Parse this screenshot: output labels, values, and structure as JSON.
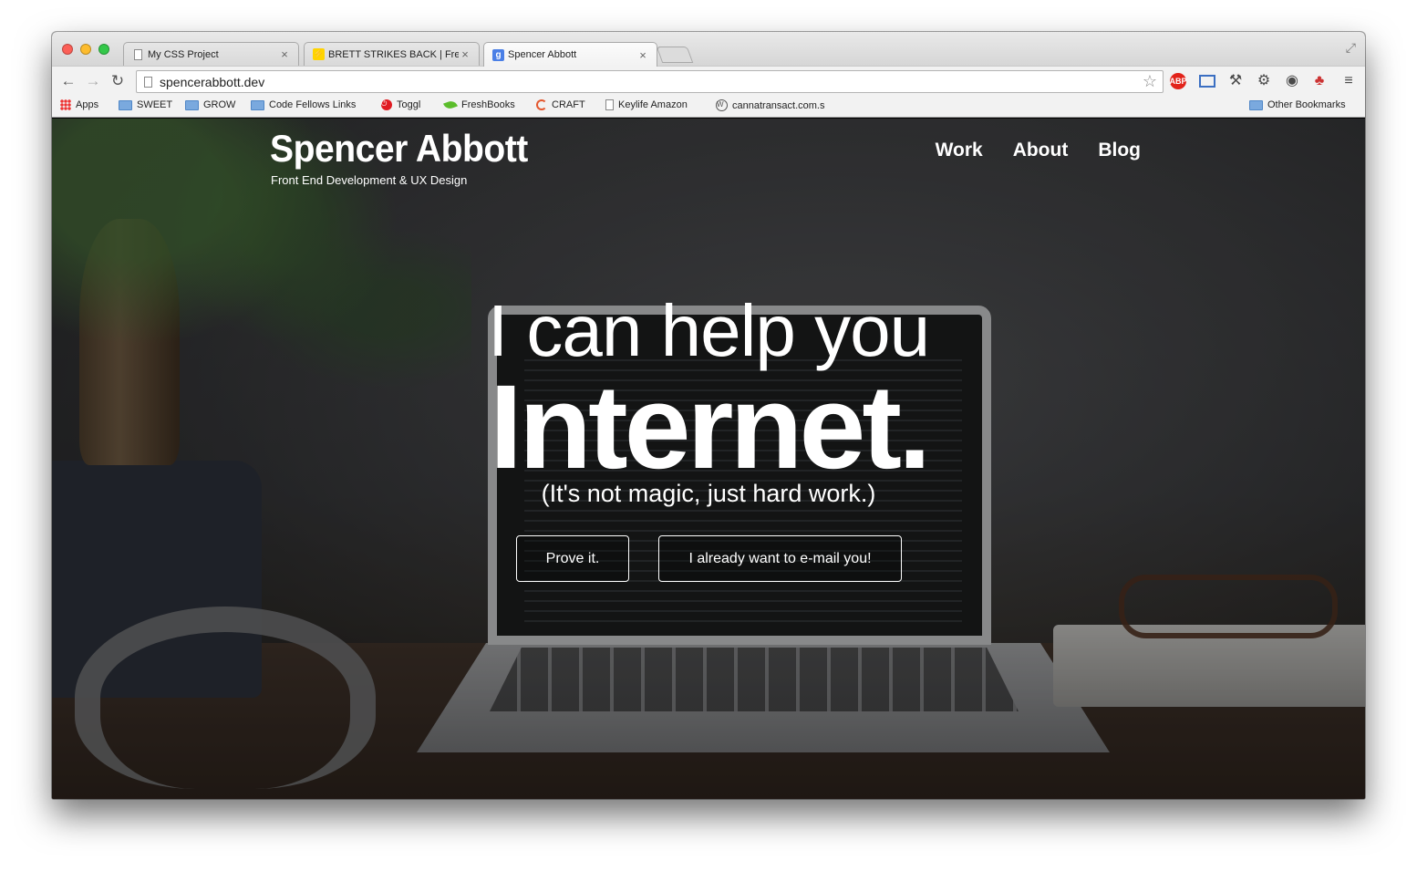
{
  "browser": {
    "tabs": [
      {
        "title": "My CSS Project",
        "favicon": "document-icon",
        "active": false
      },
      {
        "title": "BRETT STRIKES BACK | Fre",
        "favicon": "bolt-icon",
        "active": false
      },
      {
        "title": "Spencer Abbott",
        "favicon": "google-icon",
        "active": true
      }
    ],
    "close_glyph": "×",
    "url": "spencerabbott.dev",
    "bookmarks": [
      {
        "label": "Apps",
        "icon": "apps-grid-icon"
      },
      {
        "label": "SWEET",
        "icon": "folder-icon"
      },
      {
        "label": "GROW",
        "icon": "folder-icon"
      },
      {
        "label": "Code Fellows Links",
        "icon": "folder-icon"
      },
      {
        "label": "Toggl",
        "icon": "toggl-icon"
      },
      {
        "label": "FreshBooks",
        "icon": "leaf-icon"
      },
      {
        "label": "CRAFT",
        "icon": "craft-icon"
      },
      {
        "label": "Keylife Amazon",
        "icon": "file-icon"
      },
      {
        "label": "cannatransact.com.s",
        "icon": "wordpress-icon"
      }
    ],
    "other_bookmarks": "Other Bookmarks"
  },
  "site": {
    "title": "Spencer Abbott",
    "tagline": "Front End Development & UX Design",
    "nav": [
      "Work",
      "About",
      "Blog"
    ]
  },
  "hero": {
    "line1": "I can help you",
    "line2": "Internet.",
    "subtitle": "(It's not magic, just hard work.)",
    "button_prove": "Prove it.",
    "button_email": "I already want to e-mail you!"
  },
  "colors": {
    "text": "#ffffff",
    "close_red": "#fc5f57",
    "minimize_yellow": "#fdbc2e",
    "zoom_green": "#34c84a"
  }
}
